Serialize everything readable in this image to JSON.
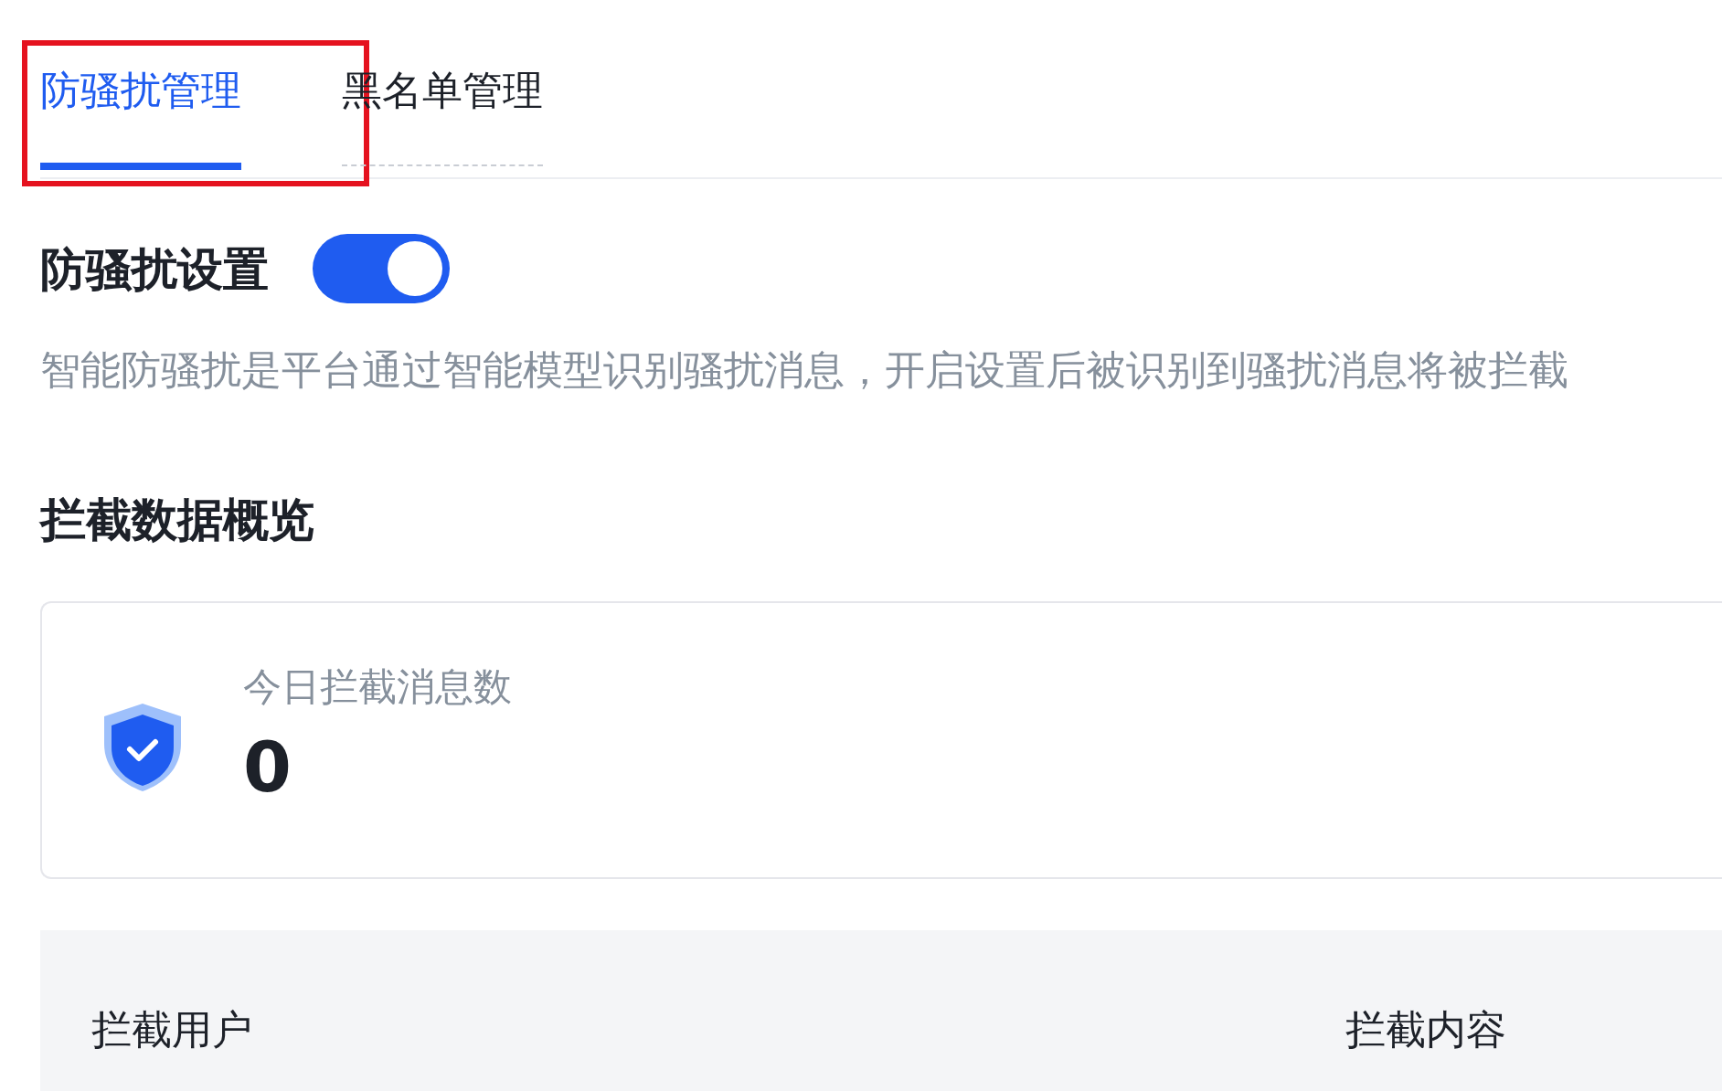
{
  "tabs": [
    {
      "label": "防骚扰管理",
      "selected": true,
      "highlighted": true
    },
    {
      "label": "黑名单管理",
      "selected": false,
      "highlighted": false
    }
  ],
  "setting": {
    "title": "防骚扰设置",
    "on": true,
    "description": "智能防骚扰是平台通过智能模型识别骚扰消息，开启设置后被识别到骚扰消息将被拦截"
  },
  "overview": {
    "title": "拦截数据概览",
    "stat_label": "今日拦截消息数",
    "stat_value": "0"
  },
  "table": {
    "columns": [
      "拦截用户",
      "拦截内容"
    ]
  }
}
